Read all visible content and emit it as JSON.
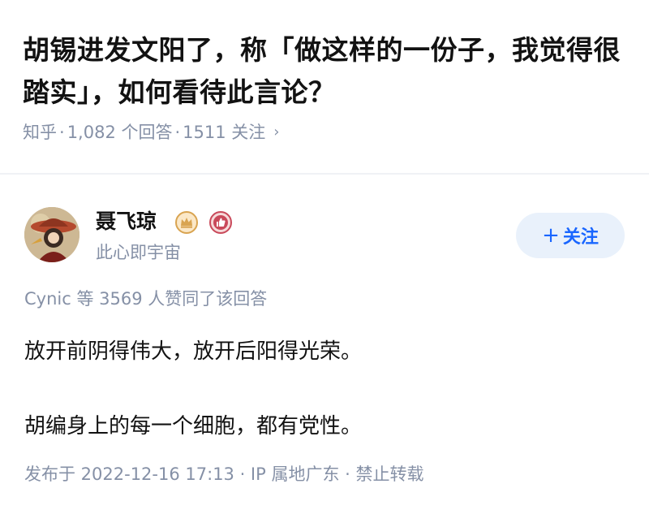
{
  "question": {
    "title": "胡锡进发文阳了，称「做这样的一份子，我觉得很踏实」，如何看待此言论？",
    "source": "知乎",
    "answer_count": "1,082 个回答",
    "follower_count": "1511 关注",
    "separator": "·",
    "chevron": "›"
  },
  "author": {
    "name": "聂飞琼",
    "signature": "此心即宇宙",
    "follow_icon": "+",
    "follow_label": "关注"
  },
  "answer": {
    "voters": "Cynic 等 3569 人赞同了该回答",
    "paragraphs": [
      "放开前阴得伟大，放开后阳得光荣。",
      "胡编身上的每一个细胞，都有党性。"
    ],
    "footer": "发布于 2022-12-16 17:13 · IP 属地广东 · 禁止转载"
  },
  "colors": {
    "accent": "#1966ff",
    "muted": "#8590a6",
    "follow_bg": "#e9f1fb"
  }
}
